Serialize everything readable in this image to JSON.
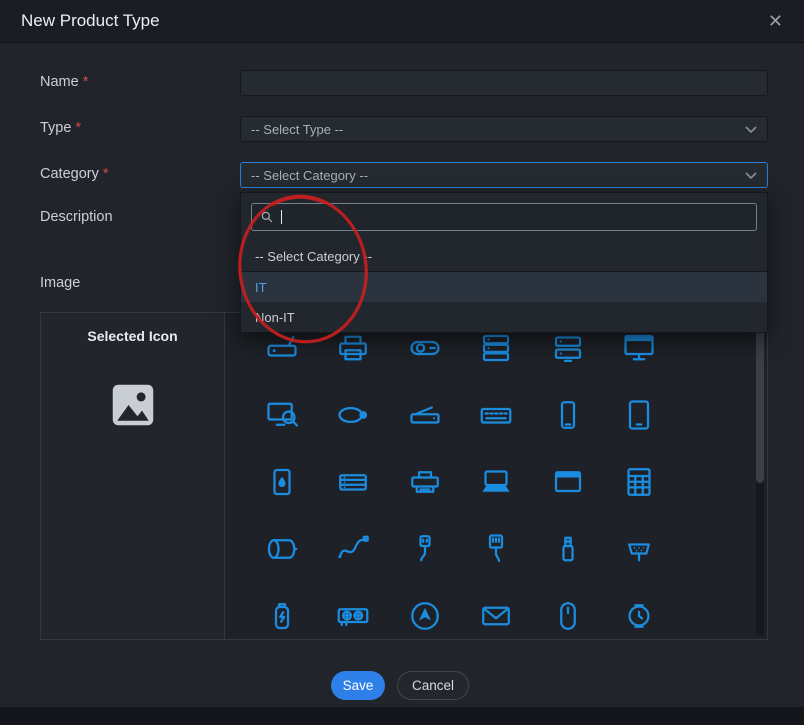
{
  "dialog": {
    "title": "New Product Type"
  },
  "form": {
    "required_marker": "*",
    "fields": [
      {
        "label": "Name",
        "required": true,
        "type": "text",
        "value": ""
      },
      {
        "label": "Type",
        "required": true,
        "type": "select",
        "value": "-- Select Type --"
      },
      {
        "label": "Category",
        "required": true,
        "type": "select",
        "value": "-- Select Category --",
        "state": "open-focused"
      },
      {
        "label": "Description",
        "required": false,
        "type": "textarea"
      },
      {
        "label": "Image",
        "required": false,
        "type": "icon-picker"
      }
    ]
  },
  "category_dropdown": {
    "search_value": "",
    "options": [
      {
        "label": "-- Select Category --",
        "highlighted": false
      },
      {
        "label": "IT",
        "highlighted": true
      },
      {
        "label": "Non-IT",
        "highlighted": false
      }
    ]
  },
  "icon_picker": {
    "heading": "Selected Icon",
    "icons": [
      "modem",
      "printer",
      "projector",
      "server",
      "server-stack",
      "monitor",
      "monitor-search",
      "wireless-mouse",
      "scanner",
      "keyboard",
      "smartphone",
      "tablet",
      "tablet-droplet",
      "rack-server",
      "dot-matrix-printer",
      "laptop",
      "browser-window",
      "spreadsheet",
      "paper-roll",
      "cable",
      "usb-cable",
      "ethernet-cable",
      "usb-drive",
      "vga-connector",
      "power-bank",
      "graphics-card",
      "trackball",
      "envelope",
      "mouse",
      "smartwatch"
    ]
  },
  "footer": {
    "save_label": "Save",
    "cancel_label": "Cancel"
  },
  "colors": {
    "accent_blue": "#2e7fe8",
    "icon_blue": "#1b8de0",
    "required_red": "#d14b44",
    "annotation_red": "#c62020",
    "highlight_text": "#4ba0e8",
    "modal_bg": "#21242b",
    "header_bg": "#1a1d23"
  },
  "annotation": {
    "shape": "hand-drawn-red-circle",
    "target": "category dropdown search + options"
  }
}
